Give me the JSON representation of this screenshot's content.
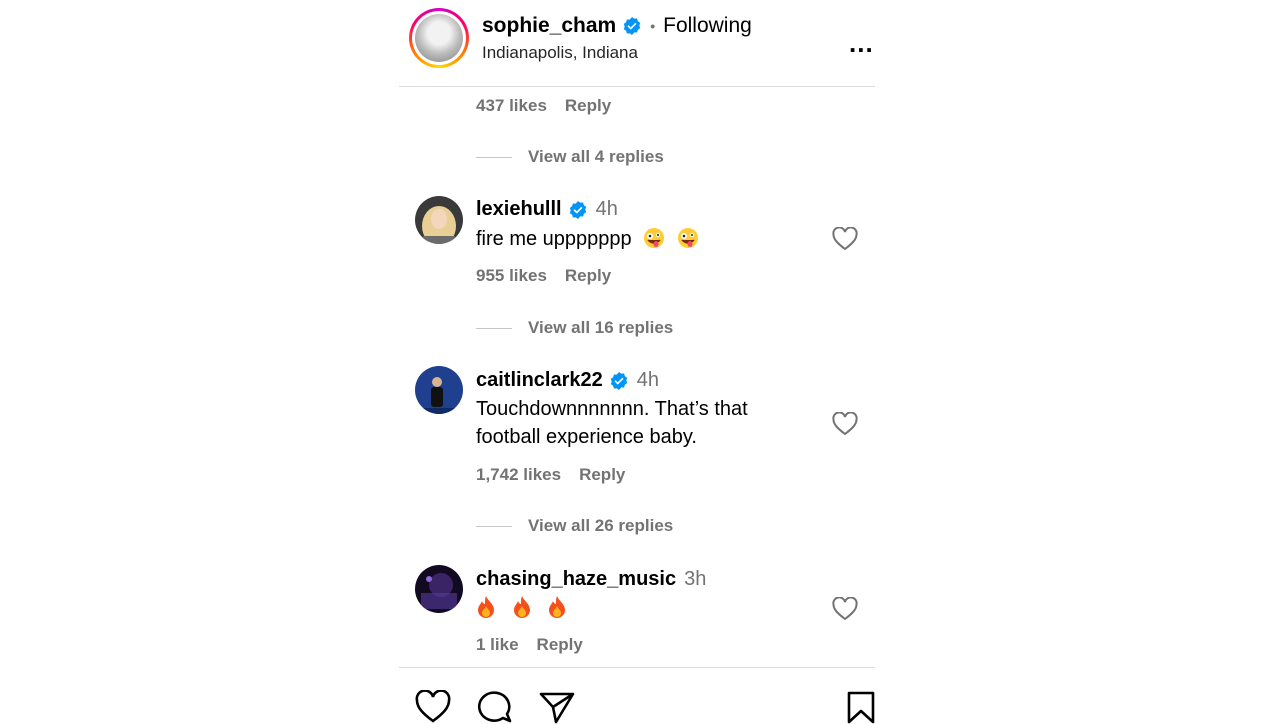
{
  "header": {
    "username": "sophie_cham",
    "dot": "•",
    "following": "Following",
    "location": "Indianapolis, Indiana",
    "more": "..."
  },
  "top_meta": {
    "likes": "437 likes",
    "reply": "Reply"
  },
  "view_replies": [
    "View all 4 replies",
    "View all 16 replies",
    "View all 26 replies"
  ],
  "comments": [
    {
      "username": "lexiehulll",
      "verified": true,
      "time": "4h",
      "text": "fire me uppppppp",
      "emoji": "zany-face",
      "likes": "955 likes",
      "reply": "Reply"
    },
    {
      "username": "caitlinclark22",
      "verified": true,
      "time": "4h",
      "text": "Touchdownnnnnnn. That’s that football experience baby.",
      "likes": "1,742 likes",
      "reply": "Reply"
    },
    {
      "username": "chasing_haze_music",
      "verified": false,
      "time": "3h",
      "text": "",
      "emoji": "fire",
      "likes": "1 like",
      "reply": "Reply"
    }
  ],
  "colors": {
    "verified": "#0095f6",
    "secondary_text": "#737373",
    "divider": "#dbdbdb"
  },
  "bottom_actions": [
    "heart-icon",
    "comment-icon",
    "share-icon",
    "bookmark-icon"
  ]
}
